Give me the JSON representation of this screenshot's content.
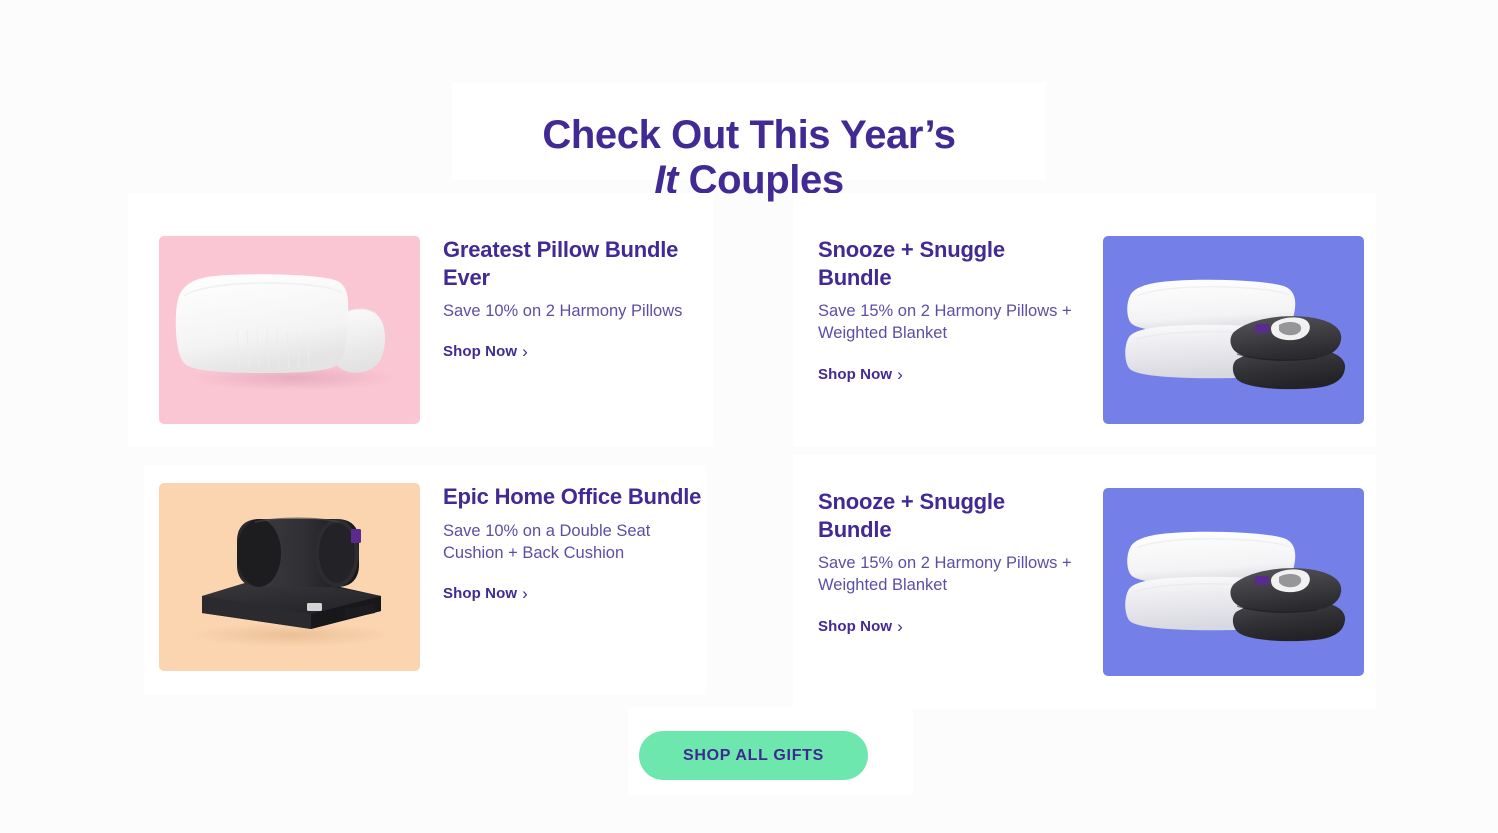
{
  "heading": {
    "line1": "Check Out This Year’s",
    "line2_italic": "It",
    "line2_rest": " Couples"
  },
  "colors": {
    "purple": "#412a94",
    "body_text": "#5a4fa6",
    "mint": "#6ee7af",
    "thumb_pink": "#fbc6d4",
    "thumb_blue": "#7480e8",
    "thumb_peach": "#fbd5b0",
    "page_bg": "#fcfcfc",
    "card_bg": "#ffffff"
  },
  "cards": [
    {
      "title": "Greatest Pillow Bundle Ever",
      "description": "Save 10% on 2 Harmony Pillows",
      "link_label": "Shop Now",
      "chevron": "›",
      "image_name": "two-white-pillows-on-pink",
      "image_bg": "#fbc6d4"
    },
    {
      "title": "Snooze + Snuggle Bundle",
      "description": "Save 15% on 2 Harmony Pillows + Weighted Blanket",
      "link_label": "Shop Now",
      "chevron": "›",
      "image_name": "stacked-pillows-and-weighted-blanket-on-blue",
      "image_bg": "#7480e8"
    },
    {
      "title": "Epic Home Office Bundle",
      "description": "Save 10% on a Double Seat Cushion + Back Cushion",
      "link_label": "Shop Now",
      "chevron": "›",
      "image_name": "back-cushion-and-seat-cushion-on-peach",
      "image_bg": "#fbd5b0"
    },
    {
      "title": "Snooze + Snuggle Bundle",
      "description": "Save 15% on 2 Harmony Pillows + Weighted Blanket",
      "link_label": "Shop Now",
      "chevron": "›",
      "image_name": "stacked-pillows-and-weighted-blanket-on-blue",
      "image_bg": "#7480e8"
    }
  ],
  "cta": {
    "label": "SHOP ALL GIFTS"
  }
}
